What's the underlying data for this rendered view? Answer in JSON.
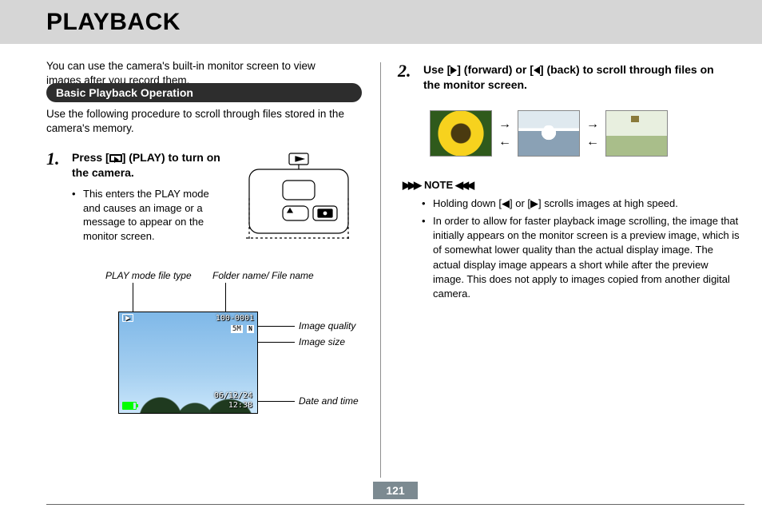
{
  "title": "PLAYBACK",
  "intro": "You can use the camera's built-in monitor screen to view images after you record them.",
  "section_heading": "Basic Playback Operation",
  "section_sub": "Use the following procedure to scroll through files stored in the camera's memory.",
  "steps": {
    "s1": {
      "num": "1.",
      "heading_pre": "Press [",
      "heading_post": "] (PLAY) to turn on the camera.",
      "bullet": "This enters the PLAY mode and causes an image or a message to appear on the monitor screen."
    },
    "s2": {
      "num": "2.",
      "heading_a": "Use [",
      "heading_b": "] (forward) or [",
      "heading_c": "] (back) to scroll through files on the monitor screen."
    }
  },
  "overlay_labels": {
    "file_type": "PLAY mode file type",
    "folder_file": "Folder name/ File name",
    "quality": "Image quality",
    "size": "Image size",
    "datetime": "Date and time"
  },
  "overlay_readouts": {
    "folder_file_value": "100-0001",
    "size_value": "5M",
    "quality_value": "N",
    "date_value": "06/12/24",
    "time_value": "12:38"
  },
  "note": {
    "label": "NOTE",
    "items": [
      "Holding down [◀] or [▶] scrolls images at high speed.",
      "In order to allow for faster playback image scrolling, the image that initially appears on the monitor screen is a preview image, which is of somewhat lower quality than the actual display image. The actual display image appears a short while after the preview image. This does not apply to images copied from another digital camera."
    ]
  },
  "page_number": "121"
}
